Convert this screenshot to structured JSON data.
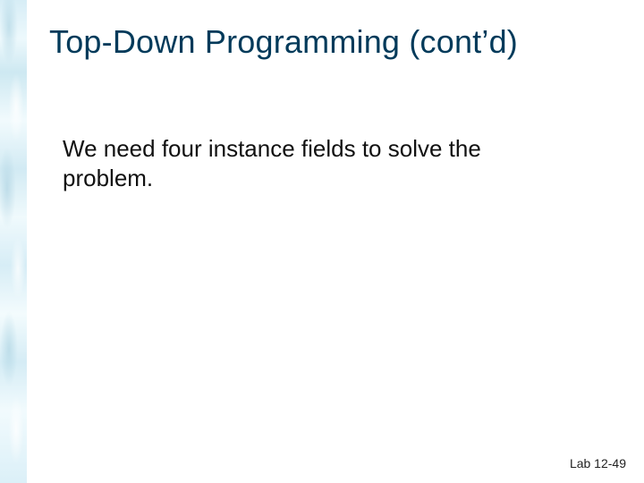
{
  "slide": {
    "title": "Top-Down Programming (cont’d)",
    "body": "We need four instance fields to solve the problem.",
    "footer": "Lab 12-49"
  }
}
